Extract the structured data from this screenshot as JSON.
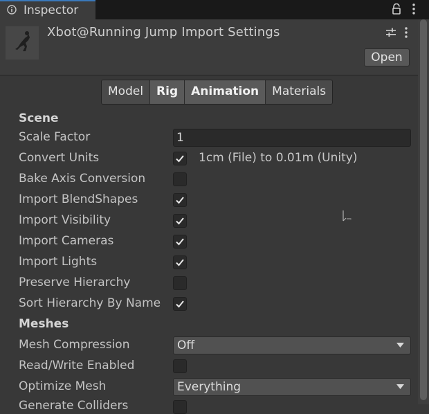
{
  "window": {
    "tab_title": "Inspector"
  },
  "header": {
    "title": "Xbot@Running Jump Import Settings",
    "open_label": "Open"
  },
  "tabs": [
    {
      "label": "Model",
      "active": false
    },
    {
      "label": "Rig",
      "active": true
    },
    {
      "label": "Animation",
      "active": true
    },
    {
      "label": "Materials",
      "active": false
    }
  ],
  "scene": {
    "heading": "Scene",
    "scale_factor": {
      "label": "Scale Factor",
      "value": "1"
    },
    "convert_units": {
      "label": "Convert Units",
      "checked": true,
      "note": "1cm (File) to 0.01m (Unity)"
    },
    "bake_axis": {
      "label": "Bake Axis Conversion",
      "checked": false
    },
    "blendshapes": {
      "label": "Import BlendShapes",
      "checked": true
    },
    "visibility": {
      "label": "Import Visibility",
      "checked": true
    },
    "cameras": {
      "label": "Import Cameras",
      "checked": true
    },
    "lights": {
      "label": "Import Lights",
      "checked": true
    },
    "preserve_hierarchy": {
      "label": "Preserve Hierarchy",
      "checked": false
    },
    "sort_hierarchy": {
      "label": "Sort Hierarchy By Name",
      "checked": true
    }
  },
  "meshes": {
    "heading": "Meshes",
    "compression": {
      "label": "Mesh Compression",
      "value": "Off"
    },
    "read_write": {
      "label": "Read/Write Enabled",
      "checked": false
    },
    "optimize": {
      "label": "Optimize Mesh",
      "value": "Everything"
    },
    "colliders": {
      "label": "Generate Colliders",
      "checked": false
    }
  },
  "colors": {
    "accent": "#3a79bb",
    "background": "#383838",
    "header": "#3c3c3c"
  }
}
